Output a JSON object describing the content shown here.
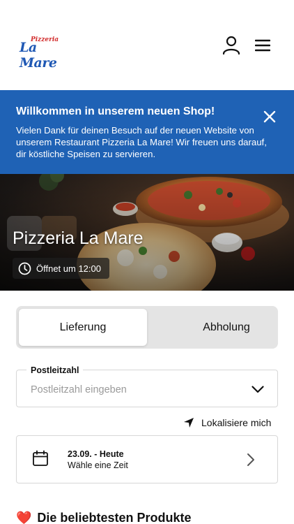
{
  "header": {
    "logo_small": "Pizzeria",
    "logo_big": "La Mare"
  },
  "banner": {
    "title": "Willkommen in unserem neuen Shop!",
    "text": "Vielen Dank für deinen Besuch auf der neuen Website von unserem Restaurant Pizzeria La Mare! Wir freuen uns darauf, dir köstliche Speisen zu servieren."
  },
  "hero": {
    "title": "Pizzeria La Mare",
    "opening": "Öffnet um 12:00"
  },
  "order_mode": {
    "delivery": "Lieferung",
    "pickup": "Abholung",
    "selected": "Lieferung"
  },
  "postal": {
    "label": "Postleitzahl",
    "placeholder": "Postleitzahl eingeben",
    "value": ""
  },
  "locate_label": "Lokalisiere mich",
  "schedule": {
    "date": "23.09. - Heute",
    "time": "Wähle eine Zeit"
  },
  "popular": {
    "emoji": "❤️",
    "title": "Die beliebtesten Produkte"
  },
  "colors": {
    "brand_blue": "#1f62b5",
    "logo_red": "#d22b2b",
    "logo_blue": "#1f58b4"
  }
}
